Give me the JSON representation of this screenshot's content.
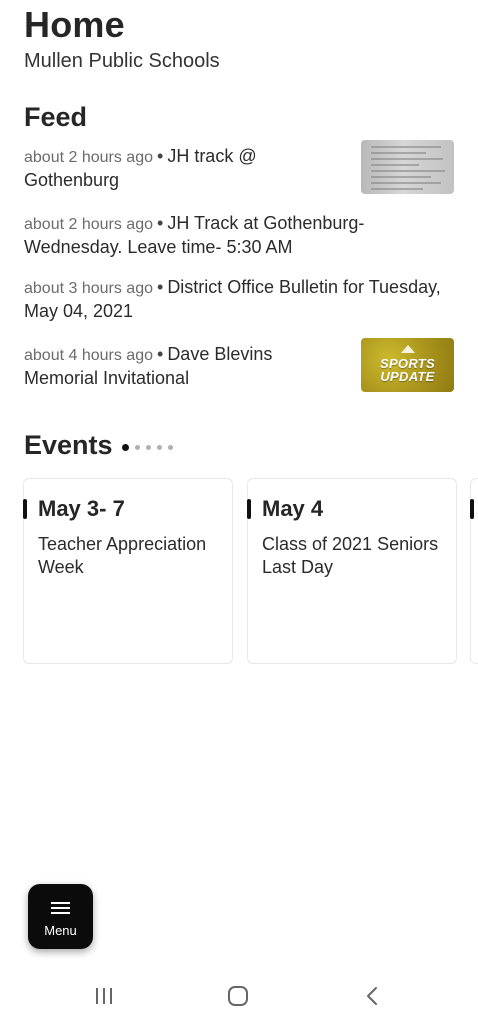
{
  "header": {
    "title": "Home",
    "subtitle": "Mullen Public Schools"
  },
  "feed": {
    "title": "Feed",
    "items": [
      {
        "time": "about 2 hours ago",
        "separator": "•",
        "text": "JH track @ Gothenburg",
        "thumbnail": "document-image"
      },
      {
        "time": "about 2 hours ago",
        "separator": "•",
        "text": "JH Track at Gothenburg- Wednesday. Leave time- 5:30 AM"
      },
      {
        "time": "about 3 hours ago",
        "separator": "•",
        "text": "District Office Bulletin for Tuesday, May 04, 2021"
      },
      {
        "time": "about 4 hours ago",
        "separator": "•",
        "text": "Dave Blevins Memorial Invitational",
        "thumbnail": "sports-update-image",
        "thumbnail_text": [
          "SPORTS",
          "UPDATE"
        ]
      }
    ]
  },
  "events": {
    "title": "Events",
    "pager": {
      "count": 5,
      "active": 0
    },
    "cards": [
      {
        "date": "May 3- 7",
        "name": "Teacher Appreciation Week"
      },
      {
        "date": "May 4",
        "name": "Class of 2021 Seniors Last Day"
      }
    ]
  },
  "menu_button": {
    "label": "Menu",
    "icon": "hamburger-icon"
  },
  "system_nav": {
    "recents_icon": "recents-icon",
    "home_icon": "home-icon",
    "back_icon": "back-icon"
  },
  "colors": {
    "accent": "#0b0b0b",
    "sports_thumb": "#a8931c"
  }
}
